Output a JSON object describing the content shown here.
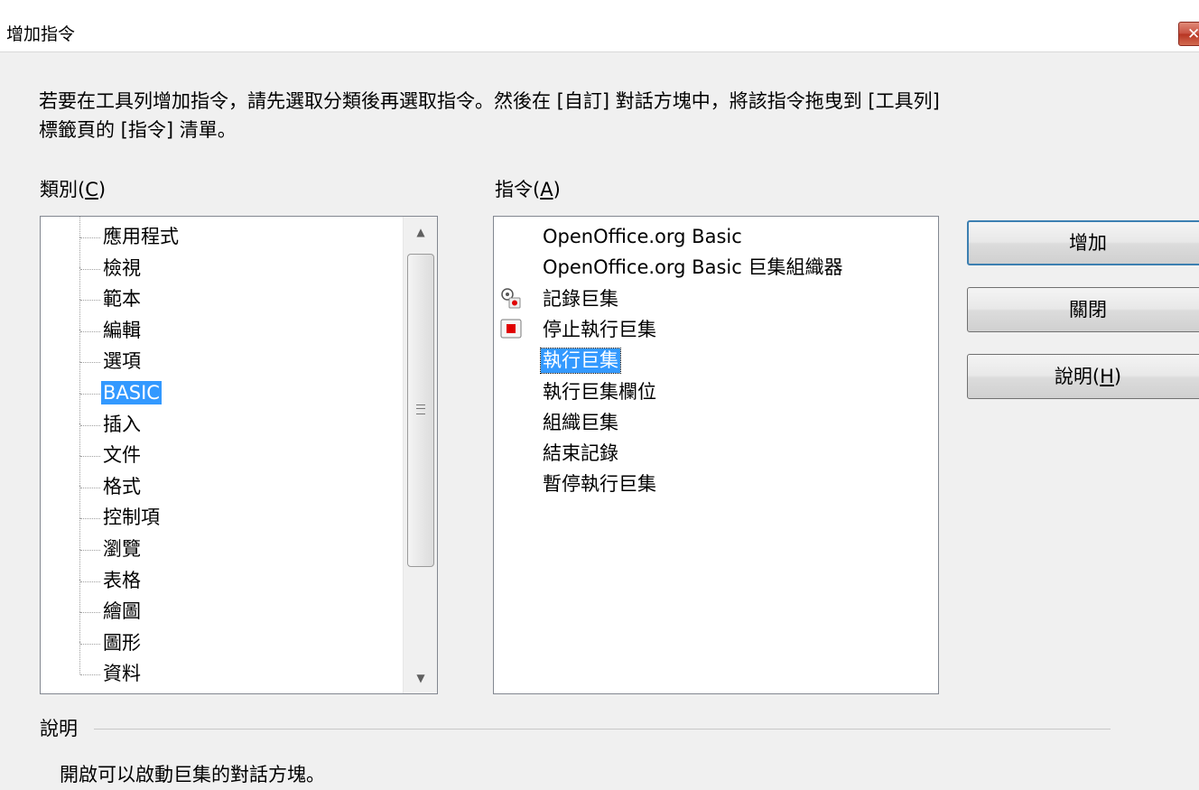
{
  "window": {
    "title": "增加指令",
    "close_glyph": "✕"
  },
  "instruction": "若要在工具列增加指令，請先選取分類後再選取指令。然後在 [自訂] 對話方塊中，將該指令拖曳到 [工具列] 標籤頁的 [指令] 清單。",
  "category": {
    "label_text": "類別(",
    "label_key": "C",
    "label_end": ")",
    "items": [
      "應用程式",
      "檢視",
      "範本",
      "編輯",
      "選項",
      "BASIC",
      "插入",
      "文件",
      "格式",
      "控制項",
      "瀏覽",
      "表格",
      "繪圖",
      "圖形",
      "資料"
    ],
    "selected": "BASIC"
  },
  "commands": {
    "label_text": "指令(",
    "label_key": "A",
    "label_end": ")",
    "items": [
      {
        "label": "OpenOffice.org Basic",
        "icon": ""
      },
      {
        "label": "OpenOffice.org Basic 巨集組織器",
        "icon": ""
      },
      {
        "label": "記錄巨集",
        "icon": "record-macro-icon"
      },
      {
        "label": "停止執行巨集",
        "icon": "stop-icon"
      },
      {
        "label": "執行巨集",
        "icon": ""
      },
      {
        "label": "執行巨集欄位",
        "icon": ""
      },
      {
        "label": "組織巨集",
        "icon": ""
      },
      {
        "label": "結束記錄",
        "icon": ""
      },
      {
        "label": "暫停執行巨集",
        "icon": ""
      }
    ],
    "selected": "執行巨集"
  },
  "buttons": {
    "add": "增加",
    "close": "關閉",
    "help_text": "說明(",
    "help_key": "H",
    "help_end": ")"
  },
  "description": {
    "label": "說明",
    "text": "開啟可以啟動巨集的對話方塊。"
  },
  "colors": {
    "selection": "#3399ff",
    "default_button_border": "#3c7fb1",
    "stop_red": "#e00000"
  }
}
